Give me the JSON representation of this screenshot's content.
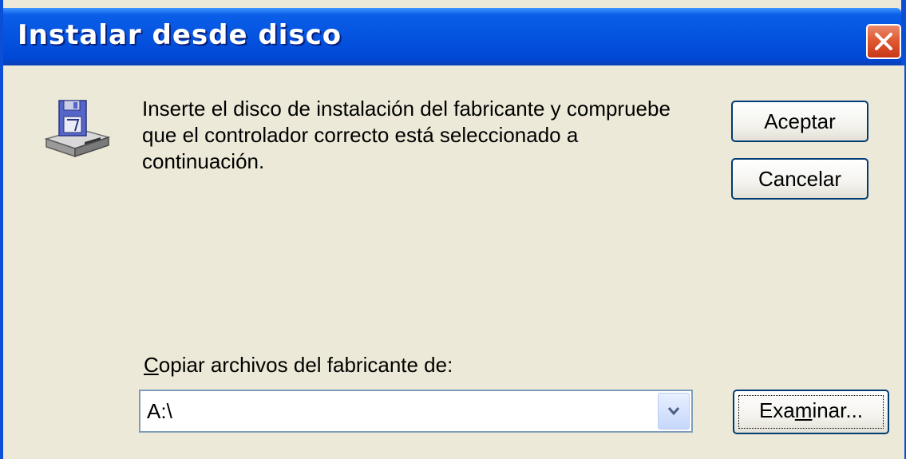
{
  "window": {
    "title": "Instalar desde disco"
  },
  "message": {
    "line1": "Inserte el disco de instalación del fabricante y compruebe",
    "line2": "que el controlador correcto está seleccionado a",
    "line3": "continuación."
  },
  "buttons": {
    "accept_label": "Aceptar",
    "cancel_label": "Cancelar",
    "browse_label_pre": "Exa",
    "browse_label_mnemonic": "m",
    "browse_label_post": "inar..."
  },
  "copy_from": {
    "label_mnemonic": "C",
    "label_rest": "opiar archivos del fabricante de:",
    "value": "A:\\"
  },
  "icons": {
    "close": "close-icon",
    "disk": "floppy-disk-drive-icon",
    "dropdown": "chevron-down-icon"
  },
  "colors": {
    "title_bar": "#0553e0",
    "dialog_background": "#ece9d8",
    "close_button": "#e05a32"
  }
}
